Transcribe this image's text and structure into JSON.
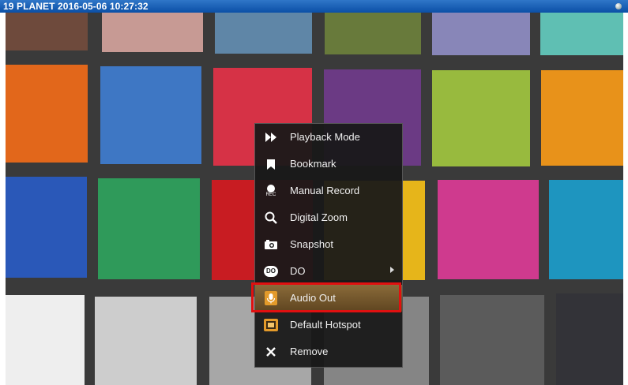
{
  "window": {
    "title": "19 PLANET   2016-05-06 10:27:32"
  },
  "colors": {
    "titlebar": "#0b4fa6",
    "menu_bg": "#181818",
    "selected_item": "#7a5a2c",
    "highlight_border": "#e01010",
    "video_grid_line": "#3a3a3a"
  },
  "context_menu": {
    "items": [
      {
        "label": "Playback Mode",
        "icon": "fast-forward-icon"
      },
      {
        "label": "Bookmark",
        "icon": "bookmark-icon"
      },
      {
        "label": "Manual Record",
        "icon": "record-icon",
        "icon_text": "REC"
      },
      {
        "label": "Digital Zoom",
        "icon": "magnifier-icon"
      },
      {
        "label": "Snapshot",
        "icon": "camera-icon"
      },
      {
        "label": "DO",
        "icon": "do-icon",
        "icon_text": "DO",
        "has_submenu": true
      },
      {
        "label": "Audio Out",
        "icon": "microphone-icon",
        "selected": true
      },
      {
        "label": "Default Hotspot",
        "icon": "hotspot-icon"
      },
      {
        "label": "Remove",
        "icon": "close-icon"
      }
    ]
  }
}
